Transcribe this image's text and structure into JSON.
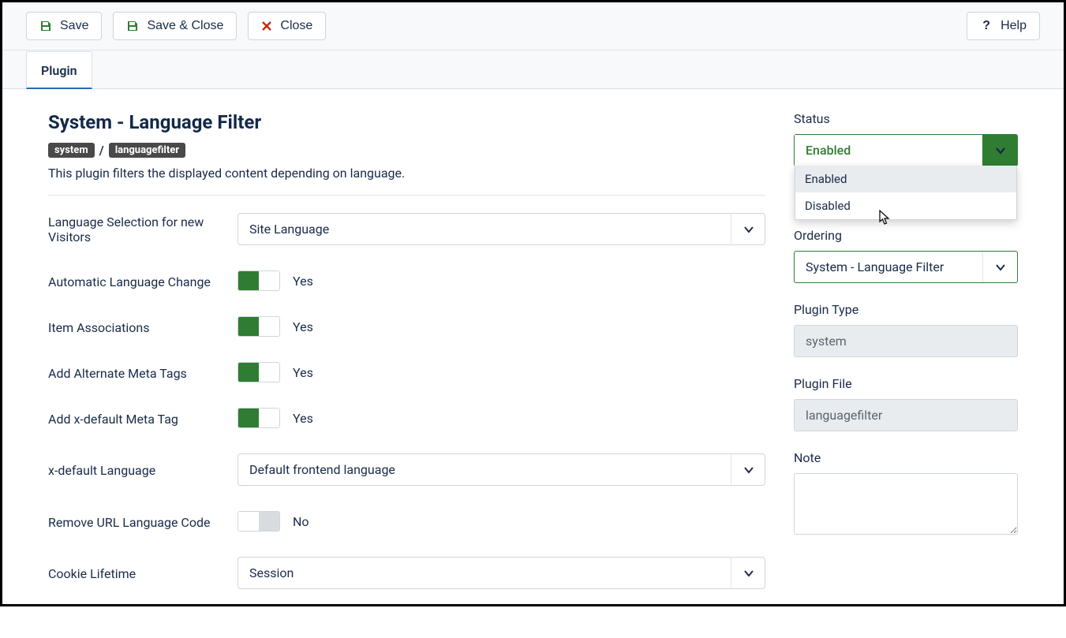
{
  "toolbar": {
    "save_label": "Save",
    "save_close_label": "Save & Close",
    "close_label": "Close",
    "help_label": "Help"
  },
  "tabs": {
    "plugin": "Plugin"
  },
  "header": {
    "title": "System - Language Filter",
    "badge_system": "system",
    "badge_file": "languagefilter",
    "description": "This plugin filters the displayed content depending on language."
  },
  "fields": {
    "lang_selection": {
      "label": "Language Selection for new Visitors",
      "value": "Site Language"
    },
    "auto_lang_change": {
      "label": "Automatic Language Change",
      "state": "on",
      "text": "Yes"
    },
    "item_assoc": {
      "label": "Item Associations",
      "state": "on",
      "text": "Yes"
    },
    "alt_meta": {
      "label": "Add Alternate Meta Tags",
      "state": "on",
      "text": "Yes"
    },
    "xdefault_meta": {
      "label": "Add x-default Meta Tag",
      "state": "on",
      "text": "Yes"
    },
    "xdefault_lang": {
      "label": "x-default Language",
      "value": "Default frontend language"
    },
    "remove_url": {
      "label": "Remove URL Language Code",
      "state": "off",
      "text": "No"
    },
    "cookie_lifetime": {
      "label": "Cookie Lifetime",
      "value": "Session"
    }
  },
  "sidebar": {
    "status": {
      "label": "Status",
      "value": "Enabled",
      "options": [
        "Enabled",
        "Disabled"
      ]
    },
    "ordering": {
      "label": "Ordering",
      "value": "System - Language Filter"
    },
    "plugin_type": {
      "label": "Plugin Type",
      "value": "system"
    },
    "plugin_file": {
      "label": "Plugin File",
      "value": "languagefilter"
    },
    "note": {
      "label": "Note",
      "value": ""
    }
  }
}
